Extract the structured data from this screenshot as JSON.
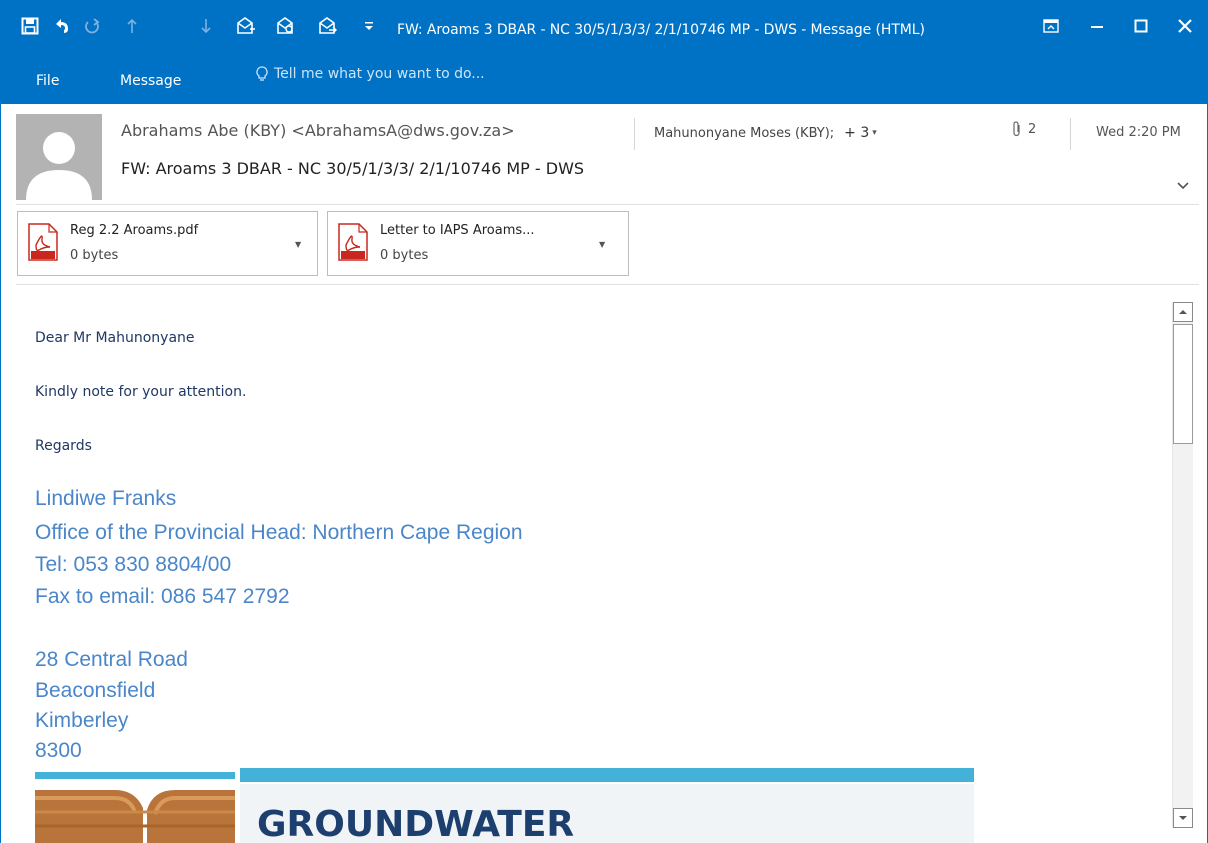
{
  "window": {
    "title": "FW: Aroams 3 DBAR - NC 30/5/1/3/3/ 2/1/10746 MP - DWS - Message (HTML)"
  },
  "ribbon": {
    "tabs": [
      "File",
      "Message"
    ],
    "tell_me": "Tell me what you want to do..."
  },
  "header": {
    "sender": "Abrahams Abe (KBY) <AbrahamsA@dws.gov.za>",
    "recipients": "Mahunonyane Moses (KBY);",
    "more_recipients": "+ 3",
    "attachment_count": "2",
    "datetime": "Wed 2:20 PM",
    "subject": "FW: Aroams 3 DBAR - NC 30/5/1/3/3/ 2/1/10746 MP - DWS"
  },
  "attachments": [
    {
      "name": "Reg 2.2 Aroams.pdf",
      "size": "0 bytes",
      "icon_label": "PDF"
    },
    {
      "name": "Letter to IAPS Aroams...",
      "size": "0 bytes",
      "icon_label": "PDF"
    }
  ],
  "body": {
    "greeting": "Dear Mr Mahunonyane",
    "line1": "Kindly note for your attention.",
    "closing": "Regards",
    "signature": [
      "Lindiwe Franks",
      "Office of the Provincial Head: Northern Cape Region",
      "Tel: 053 830 8804/00",
      "Fax to email: 086 547 2792"
    ],
    "address": [
      "28 Central Road",
      "Beaconsfield",
      "Kimberley",
      "8300"
    ],
    "banner_text": "GROUNDWATER"
  },
  "colors": {
    "titlebar": "#0072c6",
    "signature_text": "#4a86c9",
    "body_text": "#1f3864"
  }
}
